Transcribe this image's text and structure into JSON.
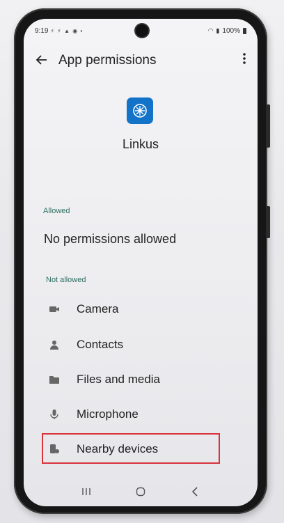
{
  "status_bar": {
    "time": "9:19",
    "battery": "100%"
  },
  "app_bar": {
    "title": "App permissions"
  },
  "app": {
    "name": "Linkus"
  },
  "allowed": {
    "label": "Allowed",
    "empty_text": "No permissions allowed"
  },
  "not_allowed": {
    "label": "Not allowed",
    "items": [
      {
        "label": "Camera",
        "icon": "camera-icon"
      },
      {
        "label": "Contacts",
        "icon": "person-icon"
      },
      {
        "label": "Files and media",
        "icon": "folder-icon"
      },
      {
        "label": "Microphone",
        "icon": "microphone-icon"
      },
      {
        "label": "Nearby devices",
        "icon": "nearby-devices-icon"
      }
    ]
  },
  "colors": {
    "accent": "#2d6e5f",
    "highlight": "#d8323b",
    "app_icon": "#1273c8"
  }
}
